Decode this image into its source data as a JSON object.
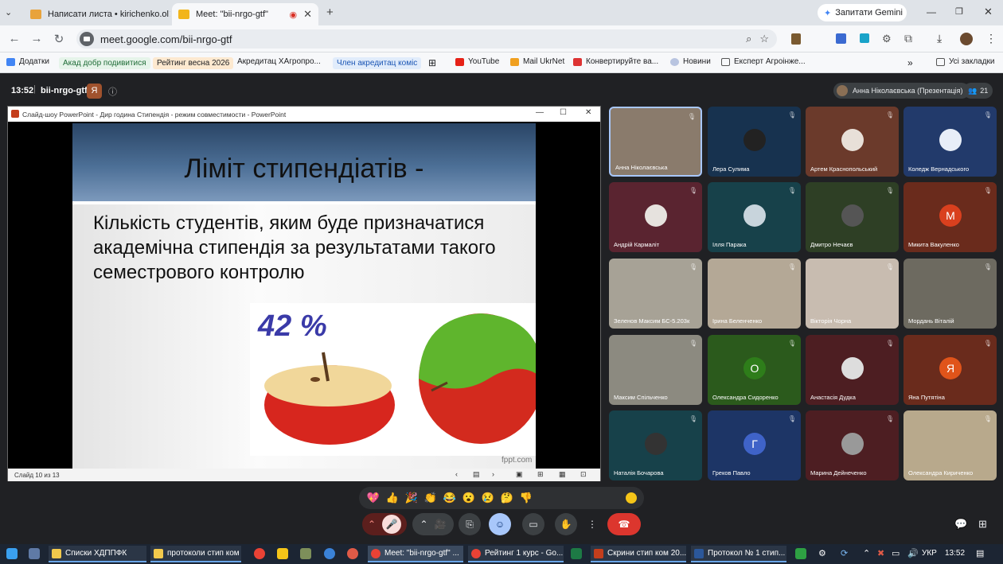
{
  "browser": {
    "tabs": [
      {
        "title": "Написати листа • kirichenko.ol",
        "active": false
      },
      {
        "title": "Meet: \"bii-nrgo-gtf\"",
        "active": true
      }
    ],
    "new_tab": "+",
    "gemini": "Запитати Gemini",
    "url": "meet.google.com/bii-nrgo-gtf",
    "bookmarks": [
      "Додатки",
      "Акад добр подивитися",
      "Рейтинг весна 2026",
      "Акредитац ХАгропро...",
      "Член акредитац коміс",
      "YouTube",
      "Mail UkrNet",
      "Конвертируйте ва...",
      "Новини",
      "Експерт Агроінже..."
    ],
    "bookmarks_overflow": "»",
    "all_bookmarks": "Усі закладки"
  },
  "meet": {
    "time": "13:52",
    "meeting_code": "bii-nrgo-gtf",
    "presenter": "Анна Ніколаєвська (Презентація)",
    "participant_count": "21"
  },
  "powerpoint": {
    "window_title": "Слайд-шоу PowerPoint - Дир година Стипендія - режим совместимости - PowerPoint",
    "status": "Слайд 10 из 13",
    "slide": {
      "title": "Ліміт стипендіатів -",
      "body": "Кількість студентів, яким буде призначатися академічна стипендія за результатами такого семестрового контролю",
      "percent": "42 %",
      "watermark": "fppt.com"
    }
  },
  "tiles": [
    {
      "name": "Анна Ніколаєвська",
      "bg": "#8a7b6c",
      "avatar": "",
      "avc": ""
    },
    {
      "name": "Лера Сулима",
      "bg": "#17324f",
      "avatar": "",
      "avc": "#222"
    },
    {
      "name": "Артем Краснопольський",
      "bg": "#6b3a2b",
      "avatar": "",
      "avc": "#e8e0d8"
    },
    {
      "name": "Коледж Вернадського",
      "bg": "#223a6b",
      "avatar": "",
      "avc": "#e8eef8"
    },
    {
      "name": "Андрій Кармаліт",
      "bg": "#5a2430",
      "avatar": "",
      "avc": "#e6e2de"
    },
    {
      "name": "Ілля Парака",
      "bg": "#17414a",
      "avatar": "",
      "avc": "#c8d4dc"
    },
    {
      "name": "Дмитро Нечаєв",
      "bg": "#2e3f25",
      "avatar": "",
      "avc": "#555"
    },
    {
      "name": "Микита Вакуленко",
      "bg": "#6a2b1c",
      "avatar": "М",
      "avc": "#d9401e"
    },
    {
      "name": "Зеленов Максим БС-5.203к",
      "bg": "#a7a296",
      "avatar": "",
      "avc": ""
    },
    {
      "name": "Ірина Беленченко",
      "bg": "#b4a896",
      "avatar": "",
      "avc": ""
    },
    {
      "name": "Вікторія Чорна",
      "bg": "#c8bcb0",
      "avatar": "",
      "avc": ""
    },
    {
      "name": "Мордань Віталій",
      "bg": "#6d6a60",
      "avatar": "",
      "avc": ""
    },
    {
      "name": "Максим Спільченко",
      "bg": "#8c8a80",
      "avatar": "",
      "avc": ""
    },
    {
      "name": "Олександра Сидоренко",
      "bg": "#2b5a1c",
      "avatar": "О",
      "avc": "#2e7d1a"
    },
    {
      "name": "Анастасія Дудка",
      "bg": "#4d1e22",
      "avatar": "",
      "avc": "#ddd"
    },
    {
      "name": "Яна Путятіна",
      "bg": "#6a2b1c",
      "avatar": "Я",
      "avc": "#e0541a"
    },
    {
      "name": "Наталія Бочарова",
      "bg": "#17414a",
      "avatar": "",
      "avc": "#333"
    },
    {
      "name": "Греков Павло",
      "bg": "#1d3566",
      "avatar": "Г",
      "avc": "#3f63c8"
    },
    {
      "name": "Марина Дейнеченко",
      "bg": "#4d1e22",
      "avatar": "",
      "avc": "#999"
    },
    {
      "name": "Олександра Кириченко",
      "bg": "#b8a98c",
      "avatar": "",
      "avc": ""
    }
  ],
  "reactions": [
    "💖",
    "👍",
    "🎉",
    "👏",
    "😂",
    "😮",
    "😢",
    "🤔",
    "👎"
  ],
  "taskbar": {
    "items": [
      "Списки ХДППФК",
      "протоколи стип ком",
      "Meet: \"bii-nrgo-gtf\" ...",
      "Рейтинг 1 курс - Go...",
      "Скрини стип ком 20...",
      "Протокол № 1 стип..."
    ],
    "lang": "УКР",
    "time": "13:52"
  }
}
